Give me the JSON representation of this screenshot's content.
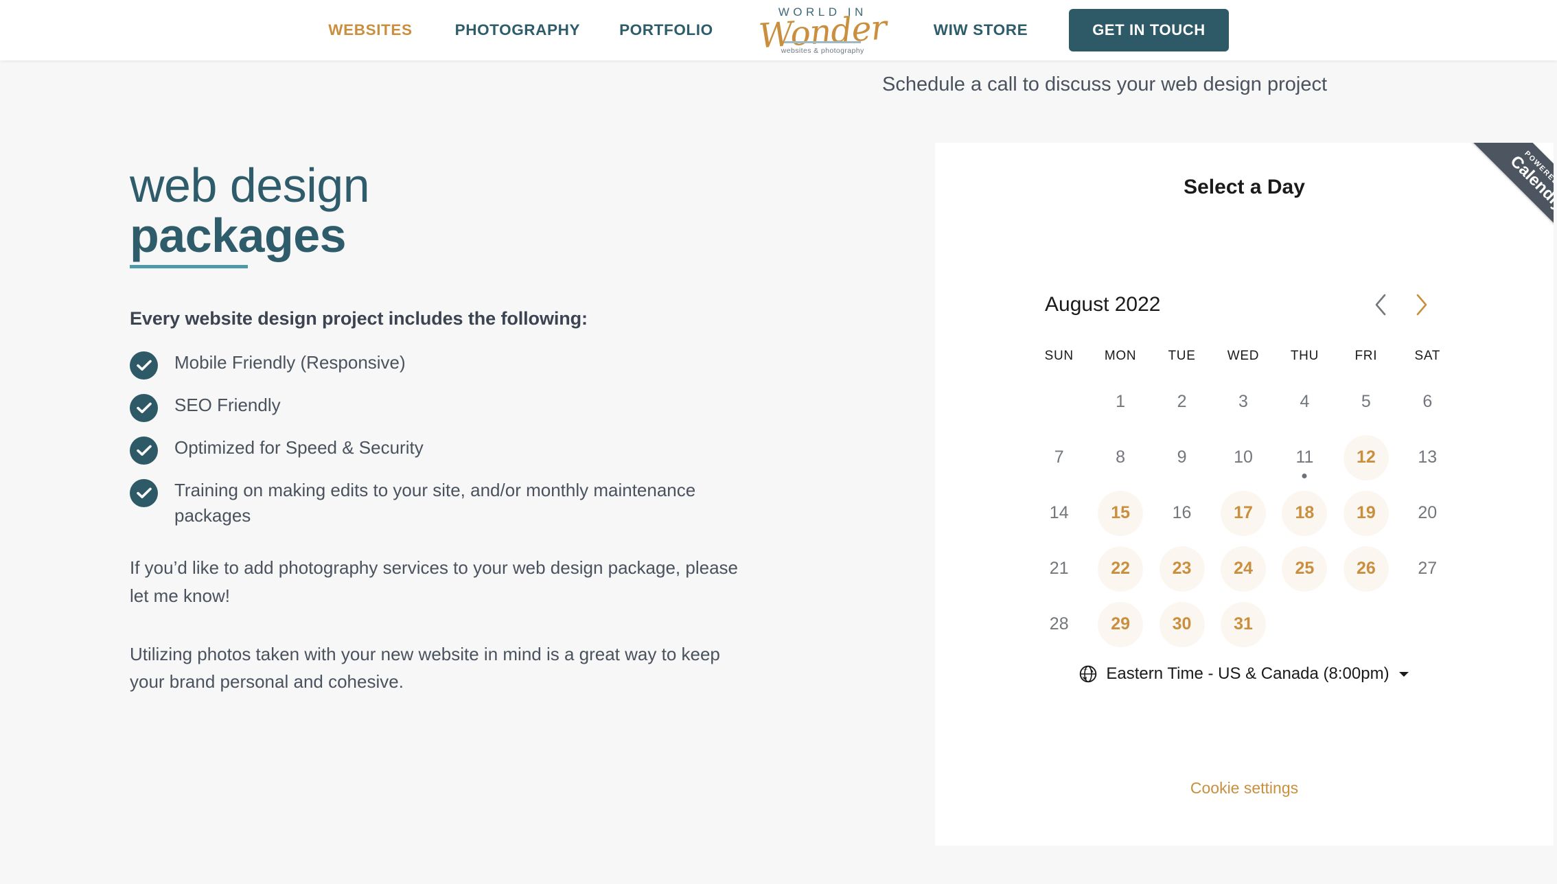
{
  "nav": {
    "links": [
      {
        "label": "WEBSITES",
        "active": true
      },
      {
        "label": "PHOTOGRAPHY",
        "active": false
      },
      {
        "label": "PORTFOLIO",
        "active": false
      },
      {
        "label": "WIW STORE",
        "active": false
      }
    ],
    "cta_label": "GET IN TOUCH",
    "logo": {
      "top_text": "WORLD IN",
      "script_text": "Wonder",
      "tagline": "websites & photography"
    },
    "colors": {
      "active_link": "#c98f3e",
      "link": "#2e5c6a",
      "cta_background": "#2d5a66",
      "cta_text": "#ffffff"
    }
  },
  "main": {
    "title_line_1": "web design",
    "title_line_2": "packages",
    "title_color": "#2e5c6a",
    "underline_color": "#4e99a6",
    "includes_heading": "Every website design project includes the following:",
    "features": [
      {
        "icon": "check-icon",
        "label": "Mobile Friendly (Responsive)"
      },
      {
        "icon": "check-icon",
        "label": "SEO Friendly"
      },
      {
        "icon": "check-icon",
        "label": "Optimized for Speed & Security"
      },
      {
        "icon": "check-icon",
        "label": "Training on making edits to your site, and/or monthly maintenance packages"
      }
    ],
    "paragraph_1": "If you’d like to add photography services to your web design package, please let me know!",
    "paragraph_2": "Utilizing photos taken with your new website in mind is a great way to keep your brand personal and cohesive."
  },
  "scheduler": {
    "section_label": "Schedule a call to discuss your web design project",
    "ribbon": {
      "powered_by": "POWERED BY",
      "brand": "Calendly",
      "background": "#4d5560"
    },
    "heading": "Select a Day",
    "month_label": "August 2022",
    "prev_month": {
      "icon": "chevron-left-icon",
      "enabled": false,
      "color": "#73777c"
    },
    "next_month": {
      "icon": "chevron-right-icon",
      "enabled": true,
      "color": "#c98f3e"
    },
    "weekdays": [
      "SUN",
      "MON",
      "TUE",
      "WED",
      "THU",
      "FRI",
      "SAT"
    ],
    "leading_blanks": 1,
    "days": [
      {
        "day": "1",
        "available": false,
        "today": false
      },
      {
        "day": "2",
        "available": false,
        "today": false
      },
      {
        "day": "3",
        "available": false,
        "today": false
      },
      {
        "day": "4",
        "available": false,
        "today": false
      },
      {
        "day": "5",
        "available": false,
        "today": false
      },
      {
        "day": "6",
        "available": false,
        "today": false
      },
      {
        "day": "7",
        "available": false,
        "today": false
      },
      {
        "day": "8",
        "available": false,
        "today": false
      },
      {
        "day": "9",
        "available": false,
        "today": false
      },
      {
        "day": "10",
        "available": false,
        "today": false
      },
      {
        "day": "11",
        "available": false,
        "today": true
      },
      {
        "day": "12",
        "available": true,
        "today": false
      },
      {
        "day": "13",
        "available": false,
        "today": false
      },
      {
        "day": "14",
        "available": false,
        "today": false
      },
      {
        "day": "15",
        "available": true,
        "today": false
      },
      {
        "day": "16",
        "available": false,
        "today": false
      },
      {
        "day": "17",
        "available": true,
        "today": false
      },
      {
        "day": "18",
        "available": true,
        "today": false
      },
      {
        "day": "19",
        "available": true,
        "today": false
      },
      {
        "day": "20",
        "available": false,
        "today": false
      },
      {
        "day": "21",
        "available": false,
        "today": false
      },
      {
        "day": "22",
        "available": true,
        "today": false
      },
      {
        "day": "23",
        "available": true,
        "today": false
      },
      {
        "day": "24",
        "available": true,
        "today": false
      },
      {
        "day": "25",
        "available": true,
        "today": false
      },
      {
        "day": "26",
        "available": true,
        "today": false
      },
      {
        "day": "27",
        "available": false,
        "today": false
      },
      {
        "day": "28",
        "available": false,
        "today": false
      },
      {
        "day": "29",
        "available": true,
        "today": false
      },
      {
        "day": "30",
        "available": true,
        "today": false
      },
      {
        "day": "31",
        "available": true,
        "today": false
      }
    ],
    "available_day_bg": "#fbf7f0",
    "available_day_text": "#c98f3e",
    "timezone": {
      "icon": "globe-icon",
      "label": "Eastern Time - US & Canada (8:00pm)",
      "caret": "caret-down-icon"
    },
    "cookie_settings_label": "Cookie settings"
  }
}
